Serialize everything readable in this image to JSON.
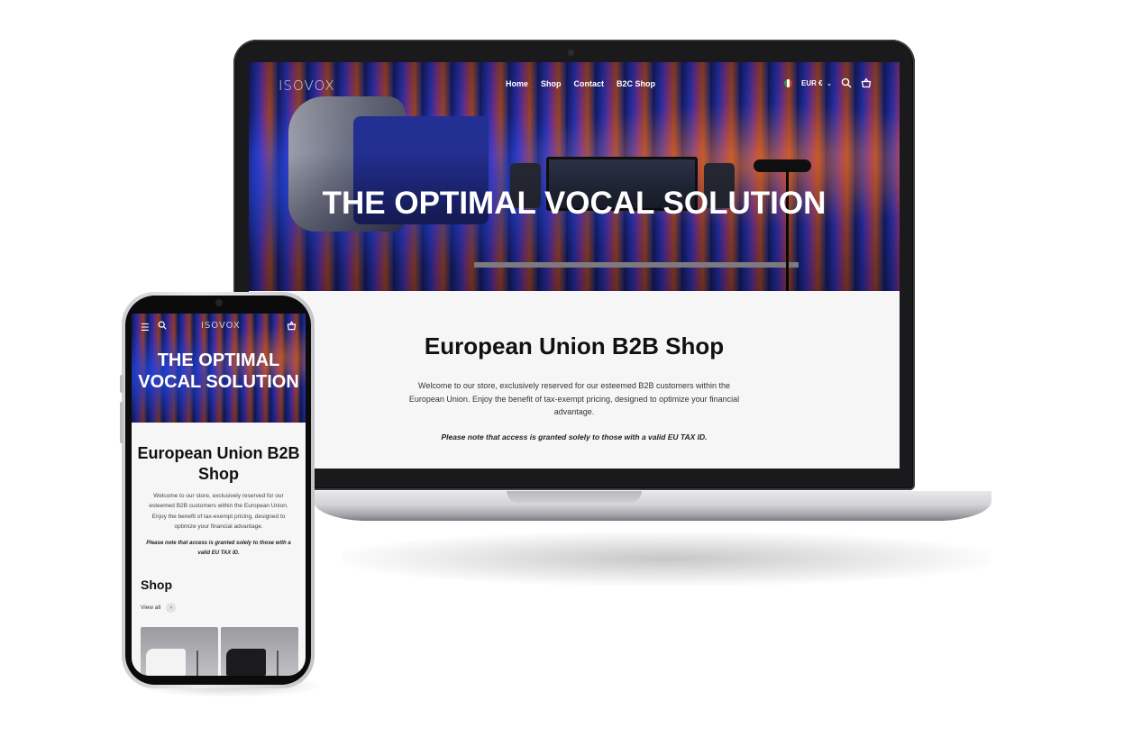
{
  "desktop": {
    "logo": "ISOVOX",
    "nav": [
      "Home",
      "Shop",
      "Contact",
      "B2C Shop"
    ],
    "currency": "EUR €",
    "hero_title": "THE OPTIMAL VOCAL SOLUTION",
    "heading": "European Union B2B Shop",
    "description": "Welcome to our store, exclusively reserved for our esteemed B2B customers within the European Union. Enjoy the benefit of tax-exempt pricing, designed to optimize your financial advantage.",
    "note": "Please note that access is granted solely to those with a valid EU TAX ID."
  },
  "mobile": {
    "logo": "ISOVOX",
    "hero_title": "THE OPTIMAL VOCAL SOLUTION",
    "heading": "European Union B2B Shop",
    "description": "Welcome to our store, exclusively reserved for our esteemed B2B customers within the European Union. Enjoy the benefit of tax-exempt pricing, designed to optimize your financial advantage.",
    "note": "Please note that access is granted solely to those with a valid EU TAX ID.",
    "shop_title": "Shop",
    "view_all": "View all"
  },
  "icons": {
    "search": "search-icon",
    "cart": "cart-icon",
    "menu": "menu-icon",
    "chevron": "chevron-down-icon",
    "flag": "italy-flag-icon"
  }
}
